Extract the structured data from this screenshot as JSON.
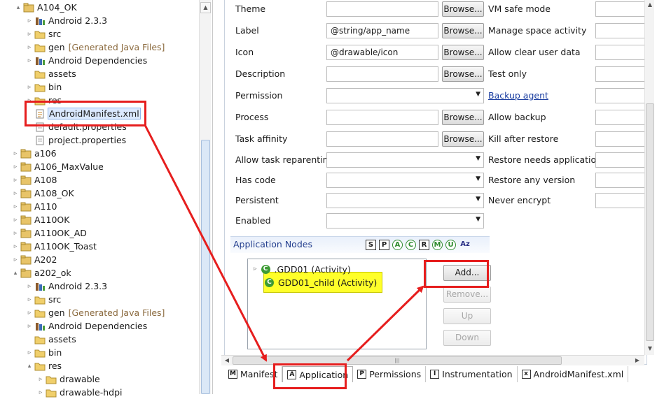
{
  "tree": {
    "items": [
      {
        "label": "A104_OK",
        "deco": "",
        "icon": "project-icon",
        "twisty": "▴"
      },
      {
        "label": "Android 2.3.3",
        "deco": "",
        "icon": "library-icon",
        "twisty": "▹"
      },
      {
        "label": "src",
        "deco": "",
        "icon": "folder-icon",
        "twisty": "▹"
      },
      {
        "label": "gen",
        "deco": "[Generated Java Files]",
        "icon": "folder-icon",
        "twisty": "▹"
      },
      {
        "label": "Android Dependencies",
        "deco": "",
        "icon": "library-icon",
        "twisty": "▹"
      },
      {
        "label": "assets",
        "deco": "",
        "icon": "folder-icon",
        "twisty": ""
      },
      {
        "label": "bin",
        "deco": "",
        "icon": "folder-icon",
        "twisty": "▹"
      },
      {
        "label": "res",
        "deco": "",
        "icon": "folder-icon",
        "twisty": "▹"
      },
      {
        "label": "AndroidManifest.xml",
        "deco": "",
        "icon": "xml-file-icon",
        "twisty": ""
      },
      {
        "label": "default.properties",
        "deco": "",
        "icon": "file-icon",
        "twisty": ""
      },
      {
        "label": "project.properties",
        "deco": "",
        "icon": "file-icon",
        "twisty": ""
      },
      {
        "label": "a106",
        "deco": "",
        "icon": "project-icon",
        "twisty": "▹"
      },
      {
        "label": "A106_MaxValue",
        "deco": "",
        "icon": "project-icon",
        "twisty": "▹"
      },
      {
        "label": "A108",
        "deco": "",
        "icon": "project-icon",
        "twisty": "▹"
      },
      {
        "label": "A108_OK",
        "deco": "",
        "icon": "project-icon",
        "twisty": "▹"
      },
      {
        "label": "A110",
        "deco": "",
        "icon": "project-icon",
        "twisty": "▹"
      },
      {
        "label": "A110OK",
        "deco": "",
        "icon": "project-icon",
        "twisty": "▹"
      },
      {
        "label": "A110OK_AD",
        "deco": "",
        "icon": "project-icon",
        "twisty": "▹"
      },
      {
        "label": "A110OK_Toast",
        "deco": "",
        "icon": "project-icon",
        "twisty": "▹"
      },
      {
        "label": "A202",
        "deco": "",
        "icon": "project-icon",
        "twisty": "▹"
      },
      {
        "label": "a202_ok",
        "deco": "",
        "icon": "project-icon",
        "twisty": "▴"
      },
      {
        "label": "Android 2.3.3",
        "deco": "",
        "icon": "library-icon",
        "twisty": "▹"
      },
      {
        "label": "src",
        "deco": "",
        "icon": "folder-icon",
        "twisty": "▹"
      },
      {
        "label": "gen",
        "deco": "[Generated Java Files]",
        "icon": "folder-icon",
        "twisty": "▹"
      },
      {
        "label": "Android Dependencies",
        "deco": "",
        "icon": "library-icon",
        "twisty": "▹"
      },
      {
        "label": "assets",
        "deco": "",
        "icon": "folder-icon",
        "twisty": ""
      },
      {
        "label": "bin",
        "deco": "",
        "icon": "folder-icon",
        "twisty": "▹"
      },
      {
        "label": "res",
        "deco": "",
        "icon": "folder-icon",
        "twisty": "▴"
      },
      {
        "label": "drawable",
        "deco": "",
        "icon": "folder-icon",
        "twisty": "▹"
      },
      {
        "label": "drawable-hdpi",
        "deco": "",
        "icon": "folder-icon",
        "twisty": "▹"
      }
    ]
  },
  "form": {
    "left": [
      {
        "label": "Theme",
        "value": "",
        "control": "text-browse"
      },
      {
        "label": "Label",
        "value": "@string/app_name",
        "control": "text-browse"
      },
      {
        "label": "Icon",
        "value": "@drawable/icon",
        "control": "text-browse"
      },
      {
        "label": "Description",
        "value": "",
        "control": "text-browse"
      },
      {
        "label": "Permission",
        "value": "",
        "control": "combo"
      },
      {
        "label": "Process",
        "value": "",
        "control": "text-browse"
      },
      {
        "label": "Task affinity",
        "value": "",
        "control": "text-browse"
      },
      {
        "label": "Allow task reparenting",
        "value": "",
        "control": "combo"
      },
      {
        "label": "Has code",
        "value": "",
        "control": "combo"
      },
      {
        "label": "Persistent",
        "value": "",
        "control": "combo"
      },
      {
        "label": "Enabled",
        "value": "",
        "control": "combo"
      }
    ],
    "browse_label": "Browse...",
    "right": [
      {
        "label": "VM safe mode",
        "link": false
      },
      {
        "label": "Manage space activity",
        "link": false
      },
      {
        "label": "Allow clear user data",
        "link": false
      },
      {
        "label": "Test only",
        "link": false
      },
      {
        "label": "Backup agent",
        "link": true
      },
      {
        "label": "Allow backup",
        "link": false
      },
      {
        "label": "Kill after restore",
        "link": false
      },
      {
        "label": "Restore needs application",
        "link": false
      },
      {
        "label": "Restore any version",
        "link": false
      },
      {
        "label": "Never encrypt",
        "link": false
      }
    ]
  },
  "app_nodes": {
    "title": "Application Nodes",
    "filters": [
      "S",
      "P",
      "A",
      "C",
      "R",
      "M",
      "U",
      "Az"
    ],
    "nodes": [
      ".GDD01 (Activity)",
      "GDD01_child (Activity)"
    ],
    "buttons": {
      "add": "Add...",
      "remove": "Remove...",
      "up": "Up",
      "down": "Down"
    }
  },
  "tabs": [
    {
      "label": "Manifest",
      "icon": "M"
    },
    {
      "label": "Application",
      "icon": "A"
    },
    {
      "label": "Permissions",
      "icon": "P"
    },
    {
      "label": "Instrumentation",
      "icon": "I"
    },
    {
      "label": "AndroidManifest.xml",
      "icon": "x"
    }
  ],
  "colors": {
    "annotation": "#e61e1e",
    "highlight": "#ffff2a",
    "link": "#1a3da0"
  }
}
